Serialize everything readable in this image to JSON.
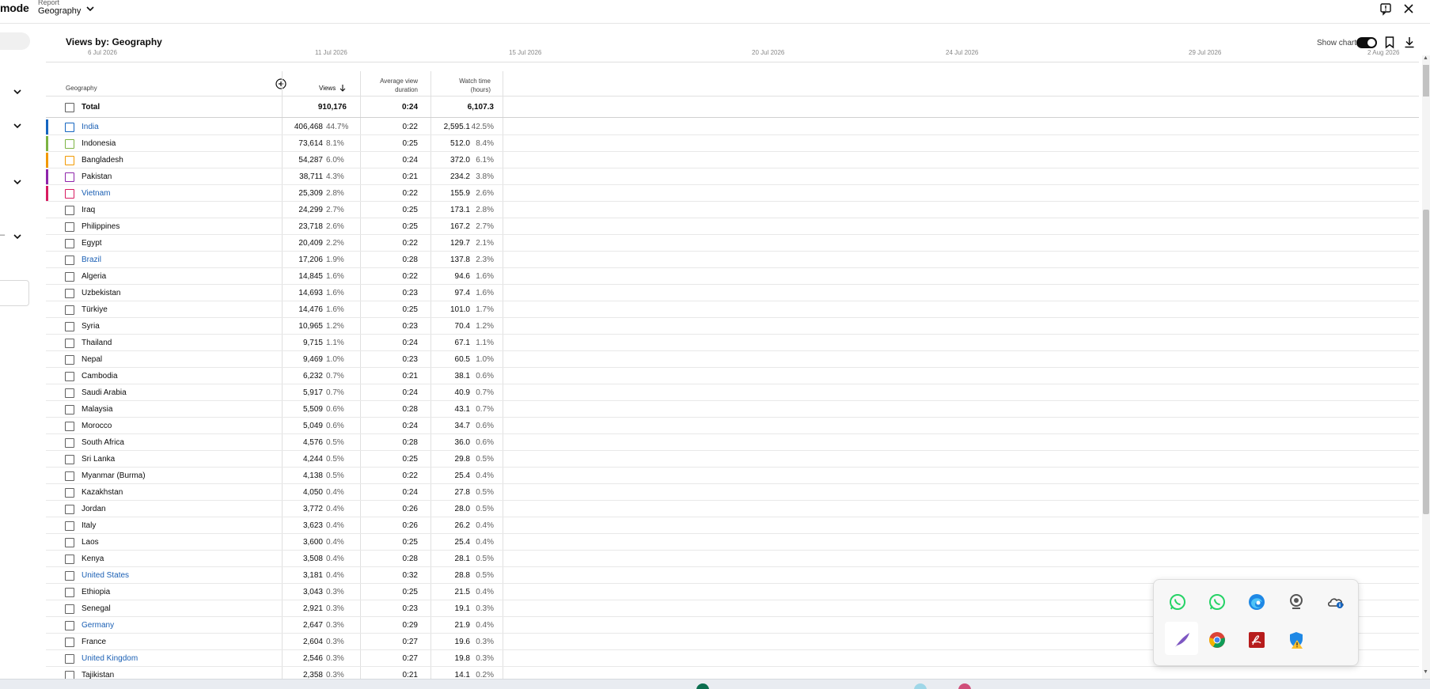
{
  "topbar": {
    "mode_text": "mode",
    "report_label": "Report",
    "report_value": "Geography"
  },
  "section": {
    "title": "Views by: Geography",
    "show_chart_label": "Show chart",
    "show_chart_on": true
  },
  "date_axis": [
    "6 Jul 2026",
    "11 Jul 2026",
    "15 Jul 2026",
    "20 Jul 2026",
    "24 Jul 2026",
    "29 Jul 2026",
    "2 Aug 2026"
  ],
  "left_panel": {
    "dash_text": "–"
  },
  "table": {
    "headers": {
      "geography": "Geography",
      "views": "Views",
      "avg_view_duration_line1": "Average view",
      "avg_view_duration_line2": "duration",
      "watch_time_line1": "Watch time",
      "watch_time_line2": "(hours)"
    },
    "total": {
      "name": "Total",
      "views": "910,176",
      "avd": "0:24",
      "wt": "6,107.3"
    },
    "rows": [
      {
        "name": "India",
        "views": "406,468",
        "views_pct": "44.7%",
        "avd": "0:22",
        "wt": "2,595.1",
        "wt_pct": "42.5%",
        "color": "#1565c0",
        "link": true
      },
      {
        "name": "Indonesia",
        "views": "73,614",
        "views_pct": "8.1%",
        "avd": "0:25",
        "wt": "512.0",
        "wt_pct": "8.4%",
        "color": "#7cb342",
        "link": false
      },
      {
        "name": "Bangladesh",
        "views": "54,287",
        "views_pct": "6.0%",
        "avd": "0:24",
        "wt": "372.0",
        "wt_pct": "6.1%",
        "color": "#f29900",
        "link": false
      },
      {
        "name": "Pakistan",
        "views": "38,711",
        "views_pct": "4.3%",
        "avd": "0:21",
        "wt": "234.2",
        "wt_pct": "3.8%",
        "color": "#8e24aa",
        "link": false
      },
      {
        "name": "Vietnam",
        "views": "25,309",
        "views_pct": "2.8%",
        "avd": "0:22",
        "wt": "155.9",
        "wt_pct": "2.6%",
        "color": "#d81b60",
        "link": true
      },
      {
        "name": "Iraq",
        "views": "24,299",
        "views_pct": "2.7%",
        "avd": "0:25",
        "wt": "173.1",
        "wt_pct": "2.8%",
        "color": "",
        "link": false
      },
      {
        "name": "Philippines",
        "views": "23,718",
        "views_pct": "2.6%",
        "avd": "0:25",
        "wt": "167.2",
        "wt_pct": "2.7%",
        "color": "",
        "link": false
      },
      {
        "name": "Egypt",
        "views": "20,409",
        "views_pct": "2.2%",
        "avd": "0:22",
        "wt": "129.7",
        "wt_pct": "2.1%",
        "color": "",
        "link": false
      },
      {
        "name": "Brazil",
        "views": "17,206",
        "views_pct": "1.9%",
        "avd": "0:28",
        "wt": "137.8",
        "wt_pct": "2.3%",
        "color": "",
        "link": true
      },
      {
        "name": "Algeria",
        "views": "14,845",
        "views_pct": "1.6%",
        "avd": "0:22",
        "wt": "94.6",
        "wt_pct": "1.6%",
        "color": "",
        "link": false
      },
      {
        "name": "Uzbekistan",
        "views": "14,693",
        "views_pct": "1.6%",
        "avd": "0:23",
        "wt": "97.4",
        "wt_pct": "1.6%",
        "color": "",
        "link": false
      },
      {
        "name": "Türkiye",
        "views": "14,476",
        "views_pct": "1.6%",
        "avd": "0:25",
        "wt": "101.0",
        "wt_pct": "1.7%",
        "color": "",
        "link": false
      },
      {
        "name": "Syria",
        "views": "10,965",
        "views_pct": "1.2%",
        "avd": "0:23",
        "wt": "70.4",
        "wt_pct": "1.2%",
        "color": "",
        "link": false
      },
      {
        "name": "Thailand",
        "views": "9,715",
        "views_pct": "1.1%",
        "avd": "0:24",
        "wt": "67.1",
        "wt_pct": "1.1%",
        "color": "",
        "link": false
      },
      {
        "name": "Nepal",
        "views": "9,469",
        "views_pct": "1.0%",
        "avd": "0:23",
        "wt": "60.5",
        "wt_pct": "1.0%",
        "color": "",
        "link": false
      },
      {
        "name": "Cambodia",
        "views": "6,232",
        "views_pct": "0.7%",
        "avd": "0:21",
        "wt": "38.1",
        "wt_pct": "0.6%",
        "color": "",
        "link": false
      },
      {
        "name": "Saudi Arabia",
        "views": "5,917",
        "views_pct": "0.7%",
        "avd": "0:24",
        "wt": "40.9",
        "wt_pct": "0.7%",
        "color": "",
        "link": false
      },
      {
        "name": "Malaysia",
        "views": "5,509",
        "views_pct": "0.6%",
        "avd": "0:28",
        "wt": "43.1",
        "wt_pct": "0.7%",
        "color": "",
        "link": false
      },
      {
        "name": "Morocco",
        "views": "5,049",
        "views_pct": "0.6%",
        "avd": "0:24",
        "wt": "34.7",
        "wt_pct": "0.6%",
        "color": "",
        "link": false
      },
      {
        "name": "South Africa",
        "views": "4,576",
        "views_pct": "0.5%",
        "avd": "0:28",
        "wt": "36.0",
        "wt_pct": "0.6%",
        "color": "",
        "link": false
      },
      {
        "name": "Sri Lanka",
        "views": "4,244",
        "views_pct": "0.5%",
        "avd": "0:25",
        "wt": "29.8",
        "wt_pct": "0.5%",
        "color": "",
        "link": false
      },
      {
        "name": "Myanmar (Burma)",
        "views": "4,138",
        "views_pct": "0.5%",
        "avd": "0:22",
        "wt": "25.4",
        "wt_pct": "0.4%",
        "color": "",
        "link": false
      },
      {
        "name": "Kazakhstan",
        "views": "4,050",
        "views_pct": "0.4%",
        "avd": "0:24",
        "wt": "27.8",
        "wt_pct": "0.5%",
        "color": "",
        "link": false
      },
      {
        "name": "Jordan",
        "views": "3,772",
        "views_pct": "0.4%",
        "avd": "0:26",
        "wt": "28.0",
        "wt_pct": "0.5%",
        "color": "",
        "link": false
      },
      {
        "name": "Italy",
        "views": "3,623",
        "views_pct": "0.4%",
        "avd": "0:26",
        "wt": "26.2",
        "wt_pct": "0.4%",
        "color": "",
        "link": false
      },
      {
        "name": "Laos",
        "views": "3,600",
        "views_pct": "0.4%",
        "avd": "0:25",
        "wt": "25.4",
        "wt_pct": "0.4%",
        "color": "",
        "link": false
      },
      {
        "name": "Kenya",
        "views": "3,508",
        "views_pct": "0.4%",
        "avd": "0:28",
        "wt": "28.1",
        "wt_pct": "0.5%",
        "color": "",
        "link": false
      },
      {
        "name": "United States",
        "views": "3,181",
        "views_pct": "0.4%",
        "avd": "0:32",
        "wt": "28.8",
        "wt_pct": "0.5%",
        "color": "",
        "link": true
      },
      {
        "name": "Ethiopia",
        "views": "3,043",
        "views_pct": "0.3%",
        "avd": "0:25",
        "wt": "21.5",
        "wt_pct": "0.4%",
        "color": "",
        "link": false
      },
      {
        "name": "Senegal",
        "views": "2,921",
        "views_pct": "0.3%",
        "avd": "0:23",
        "wt": "19.1",
        "wt_pct": "0.3%",
        "color": "",
        "link": false
      },
      {
        "name": "Germany",
        "views": "2,647",
        "views_pct": "0.3%",
        "avd": "0:29",
        "wt": "21.9",
        "wt_pct": "0.4%",
        "color": "",
        "link": true
      },
      {
        "name": "France",
        "views": "2,604",
        "views_pct": "0.3%",
        "avd": "0:27",
        "wt": "19.6",
        "wt_pct": "0.3%",
        "color": "",
        "link": false
      },
      {
        "name": "United Kingdom",
        "views": "2,546",
        "views_pct": "0.3%",
        "avd": "0:27",
        "wt": "19.8",
        "wt_pct": "0.3%",
        "color": "",
        "link": true
      },
      {
        "name": "Tajikistan",
        "views": "2,358",
        "views_pct": "0.3%",
        "avd": "0:21",
        "wt": "14.1",
        "wt_pct": "0.2%",
        "color": "",
        "link": false
      }
    ]
  },
  "tray_icons": [
    "whatsapp-icon",
    "whatsapp-icon",
    "edge-icon",
    "webcam-icon",
    "onedrive-icon",
    "feather-icon",
    "chrome-icon",
    "acrobat-icon",
    "security-warning-icon"
  ],
  "colors": {
    "link": "#1a5fb4",
    "whatsapp": "#25d366"
  }
}
